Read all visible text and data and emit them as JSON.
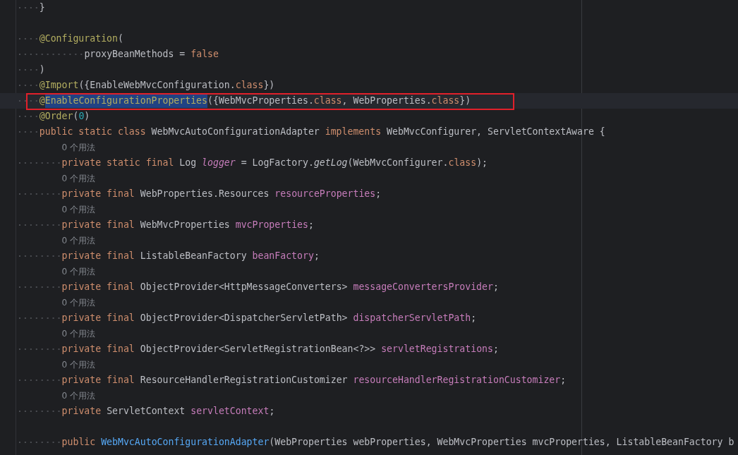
{
  "editor": {
    "lines": [
      {
        "kind": "code",
        "current": false,
        "boxed": false,
        "tokens": [
          {
            "text": "}",
            "kind": "plain"
          }
        ]
      },
      {
        "kind": "blank",
        "current": false,
        "boxed": false
      },
      {
        "kind": "code",
        "current": false,
        "boxed": false,
        "tokens": [
          {
            "text": "@Configuration",
            "kind": "annotation"
          },
          {
            "text": "(",
            "kind": "plain"
          }
        ],
        "children": [
          {
            "kind": "continuation",
            "current": false,
            "boxed": false,
            "tokens": [
              {
                "text": "proxyBeanMethods = ",
                "kind": "plain"
              },
              {
                "text": "false",
                "kind": "keyword"
              }
            ]
          }
        ]
      },
      {
        "kind": "code",
        "current": false,
        "boxed": false,
        "tokens": [
          {
            "text": ")",
            "kind": "plain"
          }
        ]
      },
      {
        "kind": "code",
        "current": false,
        "boxed": false,
        "tokens": [
          {
            "text": "@Import",
            "kind": "annotation"
          },
          {
            "text": "({EnableWebMvcConfiguration.",
            "kind": "plain"
          },
          {
            "text": "class",
            "kind": "keyword"
          },
          {
            "text": "})",
            "kind": "plain"
          }
        ]
      },
      {
        "kind": "code",
        "current": true,
        "boxed": true,
        "tokens": [
          {
            "text": "@",
            "kind": "annotation"
          },
          {
            "text": "EnableConfigurationProperties",
            "kind": "annotation",
            "selected": true
          },
          {
            "text": "({WebMvcProperties.",
            "kind": "plain"
          },
          {
            "text": "class",
            "kind": "keyword"
          },
          {
            "text": ", WebProperties.",
            "kind": "plain"
          },
          {
            "text": "class",
            "kind": "keyword"
          },
          {
            "text": "})",
            "kind": "plain"
          }
        ]
      },
      {
        "kind": "code",
        "current": false,
        "boxed": false,
        "tokens": [
          {
            "text": "@Order",
            "kind": "annotation"
          },
          {
            "text": "(",
            "kind": "plain"
          },
          {
            "text": "0",
            "kind": "number"
          },
          {
            "text": ")",
            "kind": "plain"
          }
        ]
      },
      {
        "kind": "code",
        "current": false,
        "boxed": false,
        "tokens": [
          {
            "text": "public static class ",
            "kind": "keyword"
          },
          {
            "text": "WebMvcAutoConfigurationAdapter ",
            "kind": "plain"
          },
          {
            "text": "implements ",
            "kind": "keyword"
          },
          {
            "text": "WebMvcConfigurer, ServletContextAware {",
            "kind": "plain"
          }
        ],
        "children": [
          {
            "kind": "hint",
            "current": false,
            "boxed": false,
            "text": "0 个用法"
          },
          {
            "kind": "code",
            "current": false,
            "boxed": false,
            "tokens": [
              {
                "text": "private static final ",
                "kind": "keyword"
              },
              {
                "text": "Log ",
                "kind": "plain"
              },
              {
                "text": "logger",
                "kind": "static-field"
              },
              {
                "text": " = LogFactory.",
                "kind": "plain"
              },
              {
                "text": "getLog",
                "kind": "static-call"
              },
              {
                "text": "(WebMvcConfigurer.",
                "kind": "plain"
              },
              {
                "text": "class",
                "kind": "keyword"
              },
              {
                "text": ");",
                "kind": "plain"
              }
            ]
          },
          {
            "kind": "hint",
            "current": false,
            "boxed": false,
            "text": "0 个用法"
          },
          {
            "kind": "code",
            "current": false,
            "boxed": false,
            "tokens": [
              {
                "text": "private final ",
                "kind": "keyword"
              },
              {
                "text": "WebProperties.Resources ",
                "kind": "plain"
              },
              {
                "text": "resourceProperties",
                "kind": "field"
              },
              {
                "text": ";",
                "kind": "plain"
              }
            ]
          },
          {
            "kind": "hint",
            "current": false,
            "boxed": false,
            "text": "0 个用法"
          },
          {
            "kind": "code",
            "current": false,
            "boxed": false,
            "tokens": [
              {
                "text": "private final ",
                "kind": "keyword"
              },
              {
                "text": "WebMvcProperties ",
                "kind": "plain"
              },
              {
                "text": "mvcProperties",
                "kind": "field"
              },
              {
                "text": ";",
                "kind": "plain"
              }
            ]
          },
          {
            "kind": "hint",
            "current": false,
            "boxed": false,
            "text": "0 个用法"
          },
          {
            "kind": "code",
            "current": false,
            "boxed": false,
            "tokens": [
              {
                "text": "private final ",
                "kind": "keyword"
              },
              {
                "text": "ListableBeanFactory ",
                "kind": "plain"
              },
              {
                "text": "beanFactory",
                "kind": "field"
              },
              {
                "text": ";",
                "kind": "plain"
              }
            ]
          },
          {
            "kind": "hint",
            "current": false,
            "boxed": false,
            "text": "0 个用法"
          },
          {
            "kind": "code",
            "current": false,
            "boxed": false,
            "tokens": [
              {
                "text": "private final ",
                "kind": "keyword"
              },
              {
                "text": "ObjectProvider<HttpMessageConverters> ",
                "kind": "plain"
              },
              {
                "text": "messageConvertersProvider",
                "kind": "field"
              },
              {
                "text": ";",
                "kind": "plain"
              }
            ]
          },
          {
            "kind": "hint",
            "current": false,
            "boxed": false,
            "text": "0 个用法"
          },
          {
            "kind": "code",
            "current": false,
            "boxed": false,
            "tokens": [
              {
                "text": "private final ",
                "kind": "keyword"
              },
              {
                "text": "ObjectProvider<DispatcherServletPath> ",
                "kind": "plain"
              },
              {
                "text": "dispatcherServletPath",
                "kind": "field"
              },
              {
                "text": ";",
                "kind": "plain"
              }
            ]
          },
          {
            "kind": "hint",
            "current": false,
            "boxed": false,
            "text": "0 个用法"
          },
          {
            "kind": "code",
            "current": false,
            "boxed": false,
            "tokens": [
              {
                "text": "private final ",
                "kind": "keyword"
              },
              {
                "text": "ObjectProvider<ServletRegistrationBean<?>> ",
                "kind": "plain"
              },
              {
                "text": "servletRegistrations",
                "kind": "field"
              },
              {
                "text": ";",
                "kind": "plain"
              }
            ]
          },
          {
            "kind": "hint",
            "current": false,
            "boxed": false,
            "text": "0 个用法"
          },
          {
            "kind": "code",
            "current": false,
            "boxed": false,
            "tokens": [
              {
                "text": "private final ",
                "kind": "keyword"
              },
              {
                "text": "ResourceHandlerRegistrationCustomizer ",
                "kind": "plain"
              },
              {
                "text": "resourceHandlerRegistrationCustomizer",
                "kind": "field"
              },
              {
                "text": ";",
                "kind": "plain"
              }
            ]
          },
          {
            "kind": "hint",
            "current": false,
            "boxed": false,
            "text": "0 个用法"
          },
          {
            "kind": "code",
            "current": false,
            "boxed": false,
            "tokens": [
              {
                "text": "private ",
                "kind": "keyword"
              },
              {
                "text": "ServletContext ",
                "kind": "plain"
              },
              {
                "text": "servletContext",
                "kind": "field"
              },
              {
                "text": ";",
                "kind": "plain"
              }
            ]
          },
          {
            "kind": "blank",
            "current": false,
            "boxed": false
          },
          {
            "kind": "code",
            "current": false,
            "boxed": false,
            "tokens": [
              {
                "text": "public ",
                "kind": "keyword"
              },
              {
                "text": "WebMvcAutoConfigurationAdapter",
                "kind": "method"
              },
              {
                "text": "(WebProperties webProperties, WebMvcProperties mvcProperties, ListableBeanFactory b",
                "kind": "plain"
              }
            ]
          }
        ]
      }
    ]
  }
}
